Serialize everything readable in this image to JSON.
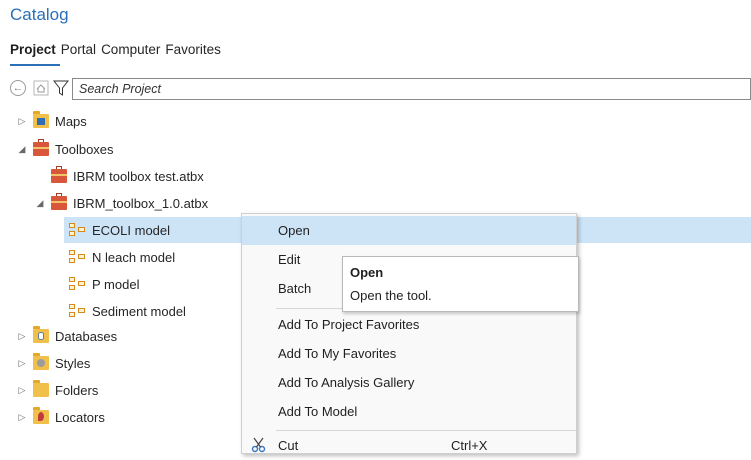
{
  "panel": {
    "title": "Catalog"
  },
  "tabs": [
    {
      "label": "Project",
      "active": true
    },
    {
      "label": "Portal",
      "active": false
    },
    {
      "label": "Computer",
      "active": false
    },
    {
      "label": "Favorites",
      "active": false
    }
  ],
  "search": {
    "placeholder": "Search Project",
    "value": ""
  },
  "tree": {
    "maps": "Maps",
    "toolboxes": "Toolboxes",
    "toolbox_test": "IBRM toolbox test.atbx",
    "toolbox_main": "IBRM_toolbox_1.0.atbx",
    "models": [
      {
        "label": "ECOLI model",
        "selected": true
      },
      {
        "label": "N leach model",
        "selected": false
      },
      {
        "label": "P model",
        "selected": false
      },
      {
        "label": "Sediment model",
        "selected": false
      }
    ],
    "databases": "Databases",
    "styles": "Styles",
    "folders": "Folders",
    "locators": "Locators"
  },
  "context_menu": {
    "open": "Open",
    "edit": "Edit",
    "batch": "Batch",
    "add_project_favorites": "Add To Project Favorites",
    "add_my_favorites": "Add To My Favorites",
    "add_analysis_gallery": "Add To Analysis Gallery",
    "add_model": "Add To Model",
    "cut": "Cut",
    "cut_shortcut": "Ctrl+X"
  },
  "tooltip": {
    "title": "Open",
    "description": "Open the tool."
  },
  "colors": {
    "accent": "#2b6fb6",
    "selection": "#cde4f7"
  }
}
